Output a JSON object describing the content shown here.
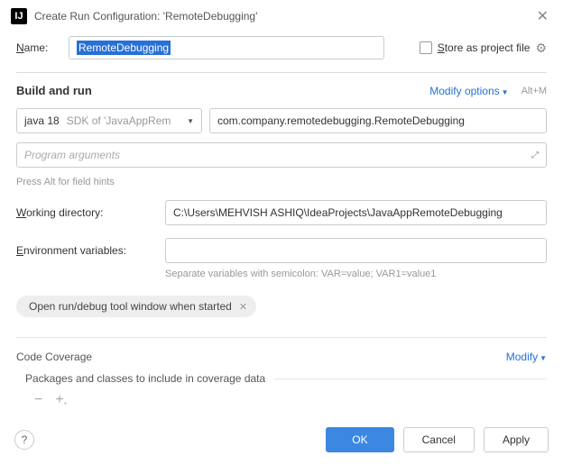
{
  "titlebar": {
    "title": "Create Run Configuration: 'RemoteDebugging'"
  },
  "name": {
    "label": "Name:",
    "value": "RemoteDebugging"
  },
  "store": {
    "label": "Store as project file"
  },
  "build_run": {
    "title": "Build and run",
    "modify_options": "Modify options",
    "shortcut": "Alt+M",
    "sdk_name": "java 18",
    "sdk_detail": "SDK of 'JavaAppRem",
    "main_class": "com.company.remotedebugging.RemoteDebugging",
    "program_args_placeholder": "Program arguments",
    "hint": "Press Alt for field hints"
  },
  "working_dir": {
    "label": "Working directory:",
    "value": "C:\\Users\\MEHVISH ASHIQ\\IdeaProjects\\JavaAppRemoteDebugging"
  },
  "env_vars": {
    "label": "Environment variables:",
    "helper": "Separate variables with semicolon: VAR=value; VAR1=value1"
  },
  "chip": {
    "label": "Open run/debug tool window when started"
  },
  "coverage": {
    "title": "Code Coverage",
    "modify": "Modify",
    "subtitle": "Packages and classes to include in coverage data"
  },
  "footer": {
    "ok": "OK",
    "cancel": "Cancel",
    "apply": "Apply"
  }
}
